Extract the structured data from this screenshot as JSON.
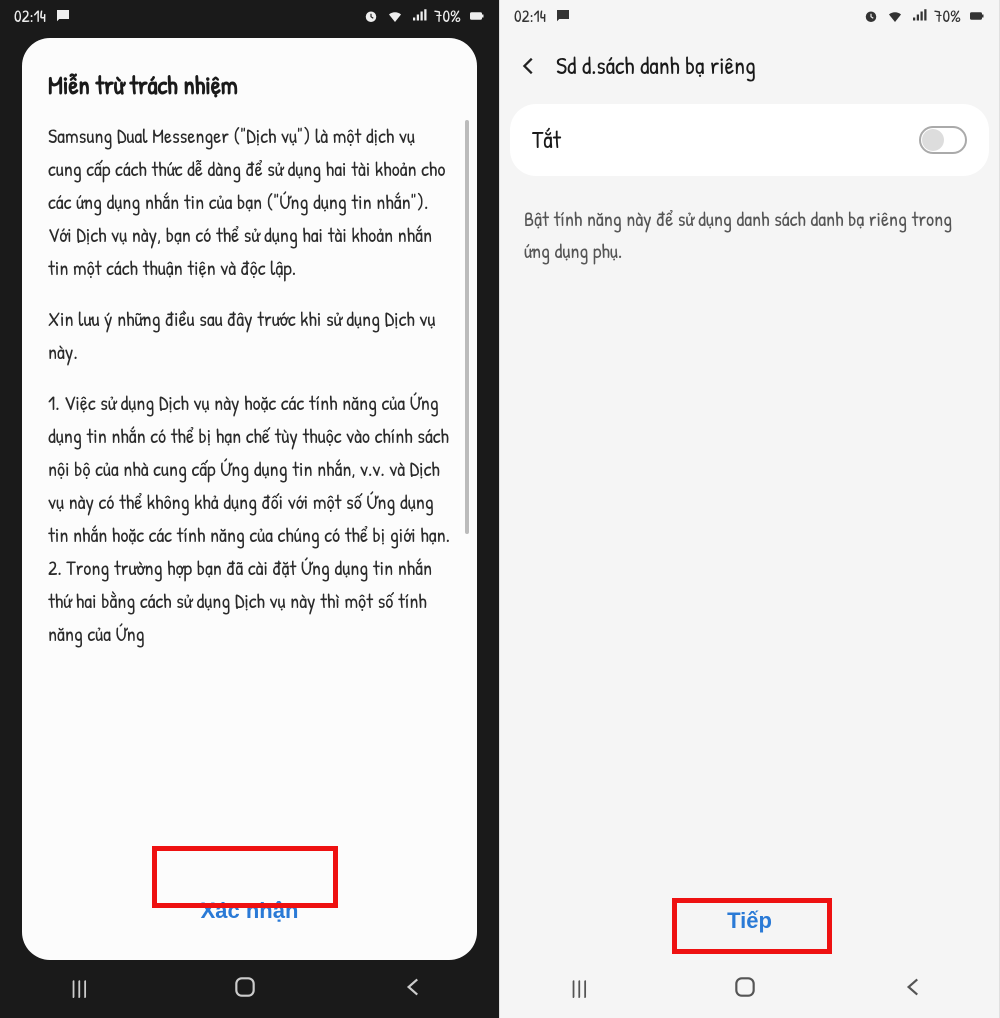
{
  "status": {
    "time": "02:14",
    "battery_text": "70%"
  },
  "phone1": {
    "dialog": {
      "title": "Miễn trừ trách nhiệm",
      "p1": "Samsung Dual Messenger (\"Dịch vụ\") là một dịch vụ cung cấp cách thức dễ dàng để sử dụng hai tài khoản cho các ứng dụng nhắn tin của bạn (\"Ứng dụng tin nhắn\").\nVới Dịch vụ này, bạn có thể sử dụng hai tài khoản nhắn tin một cách thuận tiện và độc lập.",
      "p2": "Xin lưu ý những điều sau đây trước khi sử dụng Dịch vụ này.",
      "p3": "1. Việc sử dụng Dịch vụ này hoặc các tính năng của Ứng dụng tin nhắn có thể bị hạn chế tùy thuộc vào chính sách nội bộ của nhà cung cấp Ứng dụng tin nhắn, v.v. và Dịch vụ này có thể không khả dụng đối với một số Ứng dụng tin nhắn hoặc các tính năng của chúng có thể bị giới hạn.\n2. Trong trường hợp bạn đã cài đặt Ứng dụng tin nhắn thứ hai bằng cách sử dụng Dịch vụ này thì một số tính năng của Ứng",
      "confirm_label": "Xác nhận"
    }
  },
  "phone2": {
    "header_title": "Sd d.sách danh bạ riêng",
    "toggle_label": "Tắt",
    "toggle_state": "off",
    "description": "Bật tính năng này để sử dụng danh sách danh bạ riêng trong ứng dụng phụ.",
    "next_label": "Tiếp"
  },
  "icons": {
    "chat": "chat-icon",
    "alarm": "alarm-icon",
    "wifi": "wifi-icon",
    "signal": "signal-icon",
    "battery": "battery-icon",
    "back": "back-icon",
    "nav_recent": "recent-icon",
    "nav_home": "home-icon",
    "nav_back": "nav-back-icon"
  }
}
